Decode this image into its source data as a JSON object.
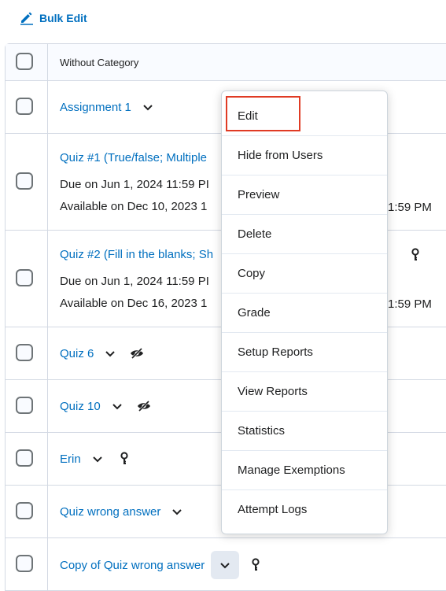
{
  "toolbar": {
    "bulk_edit_label": "Bulk Edit",
    "bulk_edit_icon": "pencil-icon"
  },
  "table": {
    "header_label": "Without Category",
    "rows": [
      {
        "title": "Assignment 1"
      },
      {
        "title": "Quiz #1 (True/false; Multiple",
        "due": "Due on Jun 1, 2024 11:59 PI",
        "available": "Available on Dec 10, 2023 1",
        "available_tail": "1:59 PM"
      },
      {
        "title": "Quiz #2 (Fill in the blanks; Sh",
        "due": "Due on Jun 1, 2024 11:59 PI",
        "available": "Available on Dec 16, 2023 1",
        "available_tail": "1:59 PM"
      },
      {
        "title": "Quiz 6"
      },
      {
        "title": "Quiz 10"
      },
      {
        "title": "Erin"
      },
      {
        "title": "Quiz wrong answer"
      },
      {
        "title": "Copy of Quiz wrong answer"
      }
    ]
  },
  "context_menu": {
    "items": [
      "Edit",
      "Hide from Users",
      "Preview",
      "Delete",
      "Copy",
      "Grade",
      "Setup Reports",
      "View Reports",
      "Statistics",
      "Manage Exemptions",
      "Attempt Logs"
    ],
    "highlighted": "Edit"
  },
  "colors": {
    "link": "#006fbf",
    "border": "#d3d9e3",
    "highlight": "#e03b24"
  }
}
